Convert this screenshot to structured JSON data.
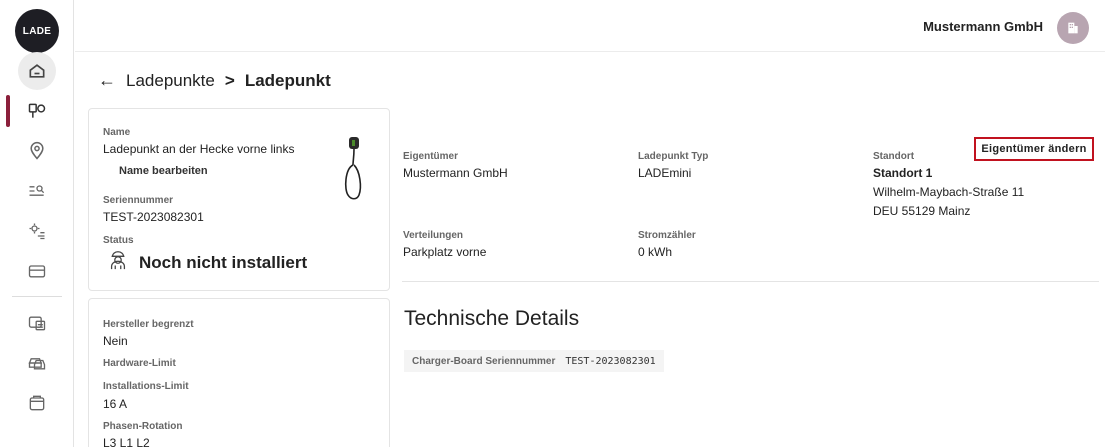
{
  "sidebar": {
    "logo_text": "LADE",
    "icons": [
      "home-icon",
      "charging-points-icon",
      "location-icon",
      "search-list-icon",
      "settings-list-icon",
      "card-icon",
      "invoice-icon",
      "vehicles-icon",
      "folder-icon"
    ]
  },
  "header": {
    "company_name": "Mustermann GmbH",
    "avatar_icon": "building-icon"
  },
  "breadcrumb": {
    "back_icon": "arrow-left-icon",
    "parent": "Ladepunkte",
    "separator": ">",
    "current": "Ladepunkt"
  },
  "card_main": {
    "name_label": "Name",
    "name_value": "Ladepunkt an der Hecke vorne links",
    "name_edit_label": "Name bearbeiten",
    "serial_label": "Seriennummer",
    "serial_value": "TEST-2023082301",
    "status_label": "Status",
    "status_value": "Noch nicht installiert",
    "status_icon": "installer-icon"
  },
  "card_limits": {
    "manufacturer_limited_label": "Hersteller begrenzt",
    "manufacturer_limited_value": "Nein",
    "hardware_limit_label": "Hardware-Limit",
    "installation_limit_label": "Installations-Limit",
    "installation_limit_value": "16 A",
    "phase_rotation_label": "Phasen-Rotation",
    "phase_rotation_value": "L3 L1 L2"
  },
  "details": {
    "owner_change_button": "Eigentümer ändern",
    "owner_label": "Eigentümer",
    "owner_value": "Mustermann GmbH",
    "type_label": "Ladepunkt Typ",
    "type_value": "LADEmini",
    "location_label": "Standort",
    "location_name": "Standort 1",
    "location_street": "Wilhelm-Maybach-Straße 11",
    "location_city": "DEU 55129 Mainz",
    "distribution_label": "Verteilungen",
    "distribution_value": "Parkplatz vorne",
    "meter_label": "Stromzähler",
    "meter_value": "0 kWh"
  },
  "technical": {
    "title": "Technische Details",
    "board_serial_label": "Charger-Board Seriennummer",
    "board_serial_value": "TEST-2023082301"
  },
  "colors": {
    "accent": "#8b1f3b",
    "highlight_border": "#c1121f"
  }
}
